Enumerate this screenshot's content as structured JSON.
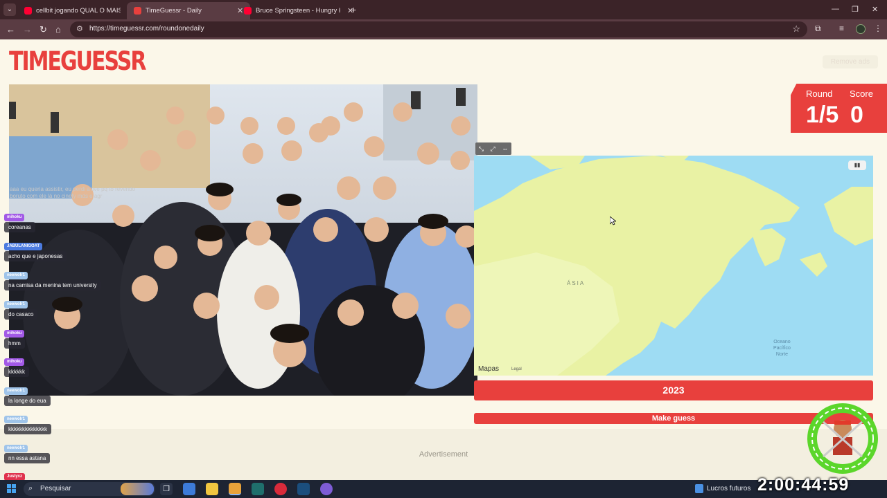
{
  "browser": {
    "tabs": [
      {
        "title": "cellbit jogando QUAL O MAIS P",
        "favicon_color": "#ff0033",
        "active": false
      },
      {
        "title": "TimeGuessr - Daily",
        "favicon_color": "#e8403d",
        "active": true
      },
      {
        "title": "Bruce Springsteen - Hungry He",
        "favicon_color": "#ff0033",
        "active": false
      }
    ],
    "url": "https://timeguessr.com/roundonedaily"
  },
  "page": {
    "logo": "TIMEGUESSR",
    "remove_ads": "Remove ads",
    "round_label": "Round",
    "score_label": "Score",
    "round_value": "1/5",
    "score_value": "0",
    "map": {
      "region_label": "ÁSIA",
      "ocean_label_line1": "Oceano",
      "ocean_label_line2": "Pacífico",
      "ocean_label_line3": "Norte",
      "brand": "Mapas",
      "legal": "Legal"
    },
    "year": "2023",
    "make_guess": "Make guess",
    "advertisement": "Advertisement"
  },
  "chat": {
    "intro": "aaa eu queria assistir, eu perdi a live pq to revendo boruto com ele lá no cinefy mds e agr",
    "messages": [
      {
        "user": "mihoku",
        "user_color": "#a259e6",
        "text": "coreanas"
      },
      {
        "user": "JABULANIGOAT",
        "user_color": "#4c7be0",
        "text": "acho que e japonesas"
      },
      {
        "user": "neewolr1",
        "user_color": "#9fc4ea",
        "text": "na camisa da menina tem university"
      },
      {
        "user": "neewolr1",
        "user_color": "#9fc4ea",
        "text": "do casaco"
      },
      {
        "user": "mihoku",
        "user_color": "#a259e6",
        "text": "hmm"
      },
      {
        "user": "mihoku",
        "user_color": "#a259e6",
        "text": "kkkkkk"
      },
      {
        "user": "neewolr1",
        "user_color": "#9fc4ea",
        "text": "la longe do eua"
      },
      {
        "user": "neewolr1",
        "user_color": "#9fc4ea",
        "text": "kkkkkkkkkkkkkk"
      },
      {
        "user": "neewolr1",
        "user_color": "#9fc4ea",
        "text": "nn essa astana"
      },
      {
        "user": "Justyxz",
        "user_color": "#e0324d",
        "text": ""
      }
    ]
  },
  "taskbar": {
    "search_placeholder": "Pesquisar",
    "weather_text": "Lucros futuros",
    "clock": "2:00:44:59"
  }
}
